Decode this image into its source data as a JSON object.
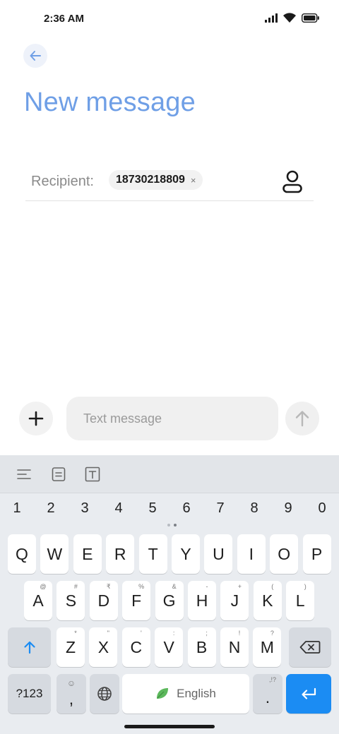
{
  "status_bar": {
    "time": "2:36 AM",
    "icons": [
      "signal-icon",
      "wifi-icon",
      "battery-icon"
    ]
  },
  "header": {
    "back_icon": "arrow-left-icon",
    "title": "New message"
  },
  "recipient": {
    "label": "Recipient:",
    "chips": [
      {
        "text": "18730218809",
        "remove": "×"
      }
    ],
    "contact_icon": "person-icon"
  },
  "compose": {
    "add_icon": "plus-icon",
    "placeholder": "Text message",
    "value": "",
    "send_icon": "arrow-up-icon"
  },
  "keyboard": {
    "toolbar": [
      "align-icon",
      "clipboard-icon",
      "text-format-icon"
    ],
    "numbers": [
      "1",
      "2",
      "3",
      "4",
      "5",
      "6",
      "7",
      "8",
      "9",
      "0"
    ],
    "row1": [
      "Q",
      "W",
      "E",
      "R",
      "T",
      "Y",
      "U",
      "I",
      "O",
      "P"
    ],
    "row2": [
      {
        "k": "A",
        "h": "@"
      },
      {
        "k": "S",
        "h": "#"
      },
      {
        "k": "D",
        "h": "₹"
      },
      {
        "k": "F",
        "h": "%"
      },
      {
        "k": "G",
        "h": "&"
      },
      {
        "k": "H",
        "h": "-"
      },
      {
        "k": "J",
        "h": "+"
      },
      {
        "k": "K",
        "h": "("
      },
      {
        "k": "L",
        "h": ")"
      }
    ],
    "row3": [
      {
        "k": "Z",
        "h": "*"
      },
      {
        "k": "X",
        "h": "\""
      },
      {
        "k": "C",
        "h": "'"
      },
      {
        "k": "V",
        "h": ":"
      },
      {
        "k": "B",
        "h": ";"
      },
      {
        "k": "N",
        "h": "!"
      },
      {
        "k": "M",
        "h": "?"
      }
    ],
    "symbols_key": "?123",
    "comma_key": ",",
    "comma_hint": "☺",
    "space_label": "English",
    "period_key": ".",
    "period_hint": ",!?",
    "colors": {
      "accent": "#1b8cf3",
      "title": "#6f9fe6",
      "leaf": "#5cb85c"
    }
  }
}
